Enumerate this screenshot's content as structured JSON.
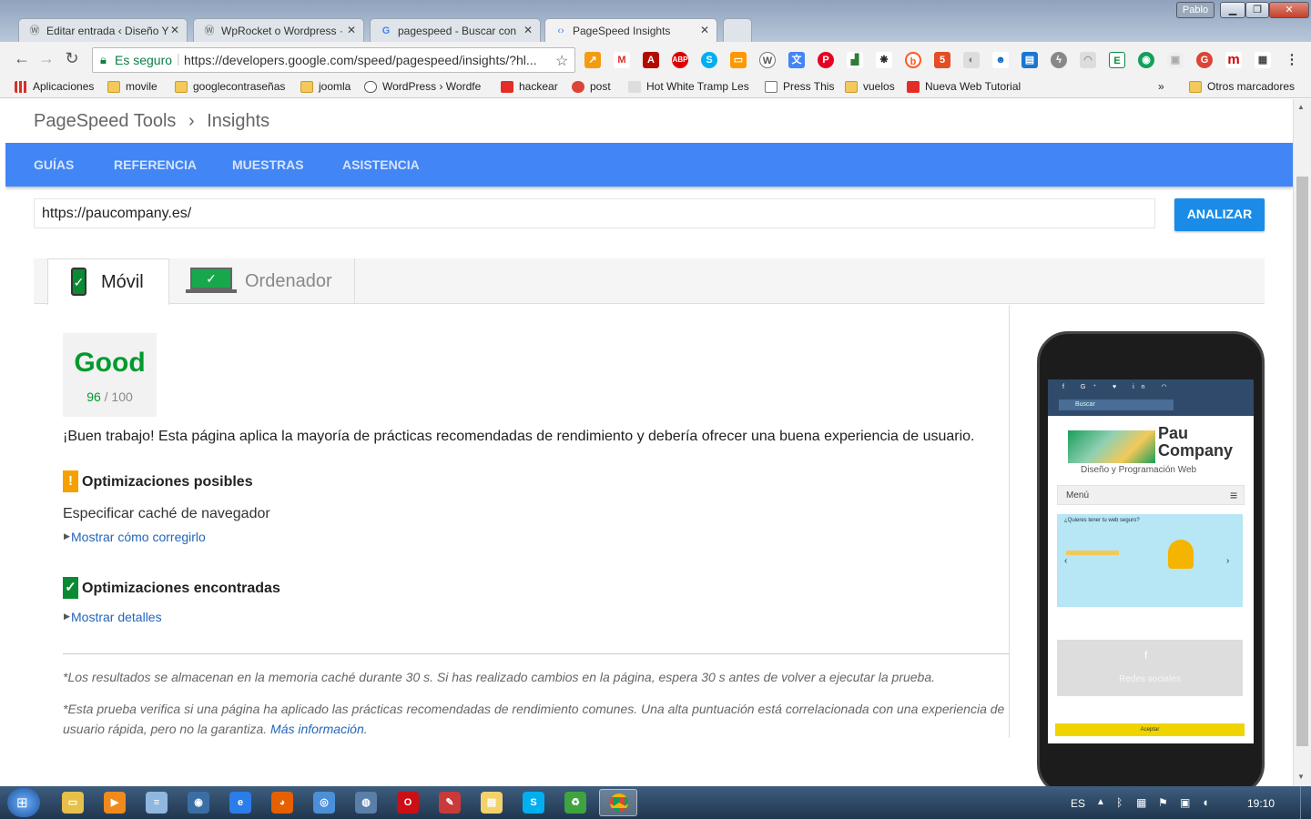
{
  "browser": {
    "user_badge": "Pablo",
    "tabs": [
      {
        "title": "Editar entrada ‹ Diseño Y",
        "icon": "wordpress-icon"
      },
      {
        "title": "WpRocket o Wordpress ·",
        "icon": "wordpress-icon"
      },
      {
        "title": "pagespeed - Buscar con",
        "icon": "google-icon"
      },
      {
        "title": "PageSpeed Insights",
        "icon": "pagespeed-icon"
      }
    ],
    "secure_label": "Es seguro",
    "url": "https://developers.google.com/speed/pagespeed/insights/?hl...",
    "bookmarks": [
      "Aplicaciones",
      "movile",
      "googlecontraseñas",
      "joomla",
      "WordPress › Wordfe",
      "hackear",
      "post",
      "Hot White Tramp Les",
      "Press This",
      "vuelos",
      "Nueva Web Tutorial"
    ],
    "bookmarks_more": "»",
    "other_bookmarks": "Otros marcadores"
  },
  "site": {
    "breadcrumb_root": "PageSpeed Tools",
    "breadcrumb_sep": "›",
    "breadcrumb_current": "Insights",
    "nav": [
      "GUÍAS",
      "REFERENCIA",
      "MUESTRAS",
      "ASISTENCIA"
    ],
    "url_value": "https://paucompany.es/",
    "analyze_label": "ANALIZAR",
    "tab_mobile": "Móvil",
    "tab_desktop": "Ordenador",
    "score_label": "Good",
    "score_value": "96",
    "score_max": "/ 100",
    "summary": "¡Buen trabajo! Esta página aplica la mayoría de prácticas recomendadas de rendimiento y debería ofrecer una buena experiencia de usuario.",
    "possible_title": "Optimizaciones posibles",
    "possible_item": "Especificar caché de navegador",
    "show_fix": "Mostrar cómo corregirlo",
    "found_title": "Optimizaciones encontradas",
    "show_details": "Mostrar detalles",
    "note1": "*Los resultados se almacenan en la memoria caché durante 30 s. Si has realizado cambios en la página, espera 30 s antes de volver a ejecutar la prueba.",
    "note2": "*Esta prueba verifica si una página ha aplicado las prácticas recomendadas de rendimiento comunes. Una alta puntuación está correlacionada con una experiencia de usuario rápida, pero no la garantiza.",
    "more_info": "Más información",
    "note2_end": ".",
    "colors": {
      "nav_blue": "#4285f4",
      "good_green": "#009a2e",
      "warn_orange": "#f4a000",
      "link_blue": "#2266bb"
    }
  },
  "phone": {
    "search_placeholder": "Buscar",
    "brand_line1": "Pau",
    "brand_line2": "Company",
    "brand_sub": "Diseño y Programación Web",
    "menu_label": "Menú",
    "menu_icon": "≡",
    "banner_title": "¿Quieres tener tu web seguro?",
    "social_label": "Redes sociales",
    "yellow_btn": "Aceptar"
  },
  "taskbar": {
    "lang": "ES",
    "time": "19:10"
  }
}
